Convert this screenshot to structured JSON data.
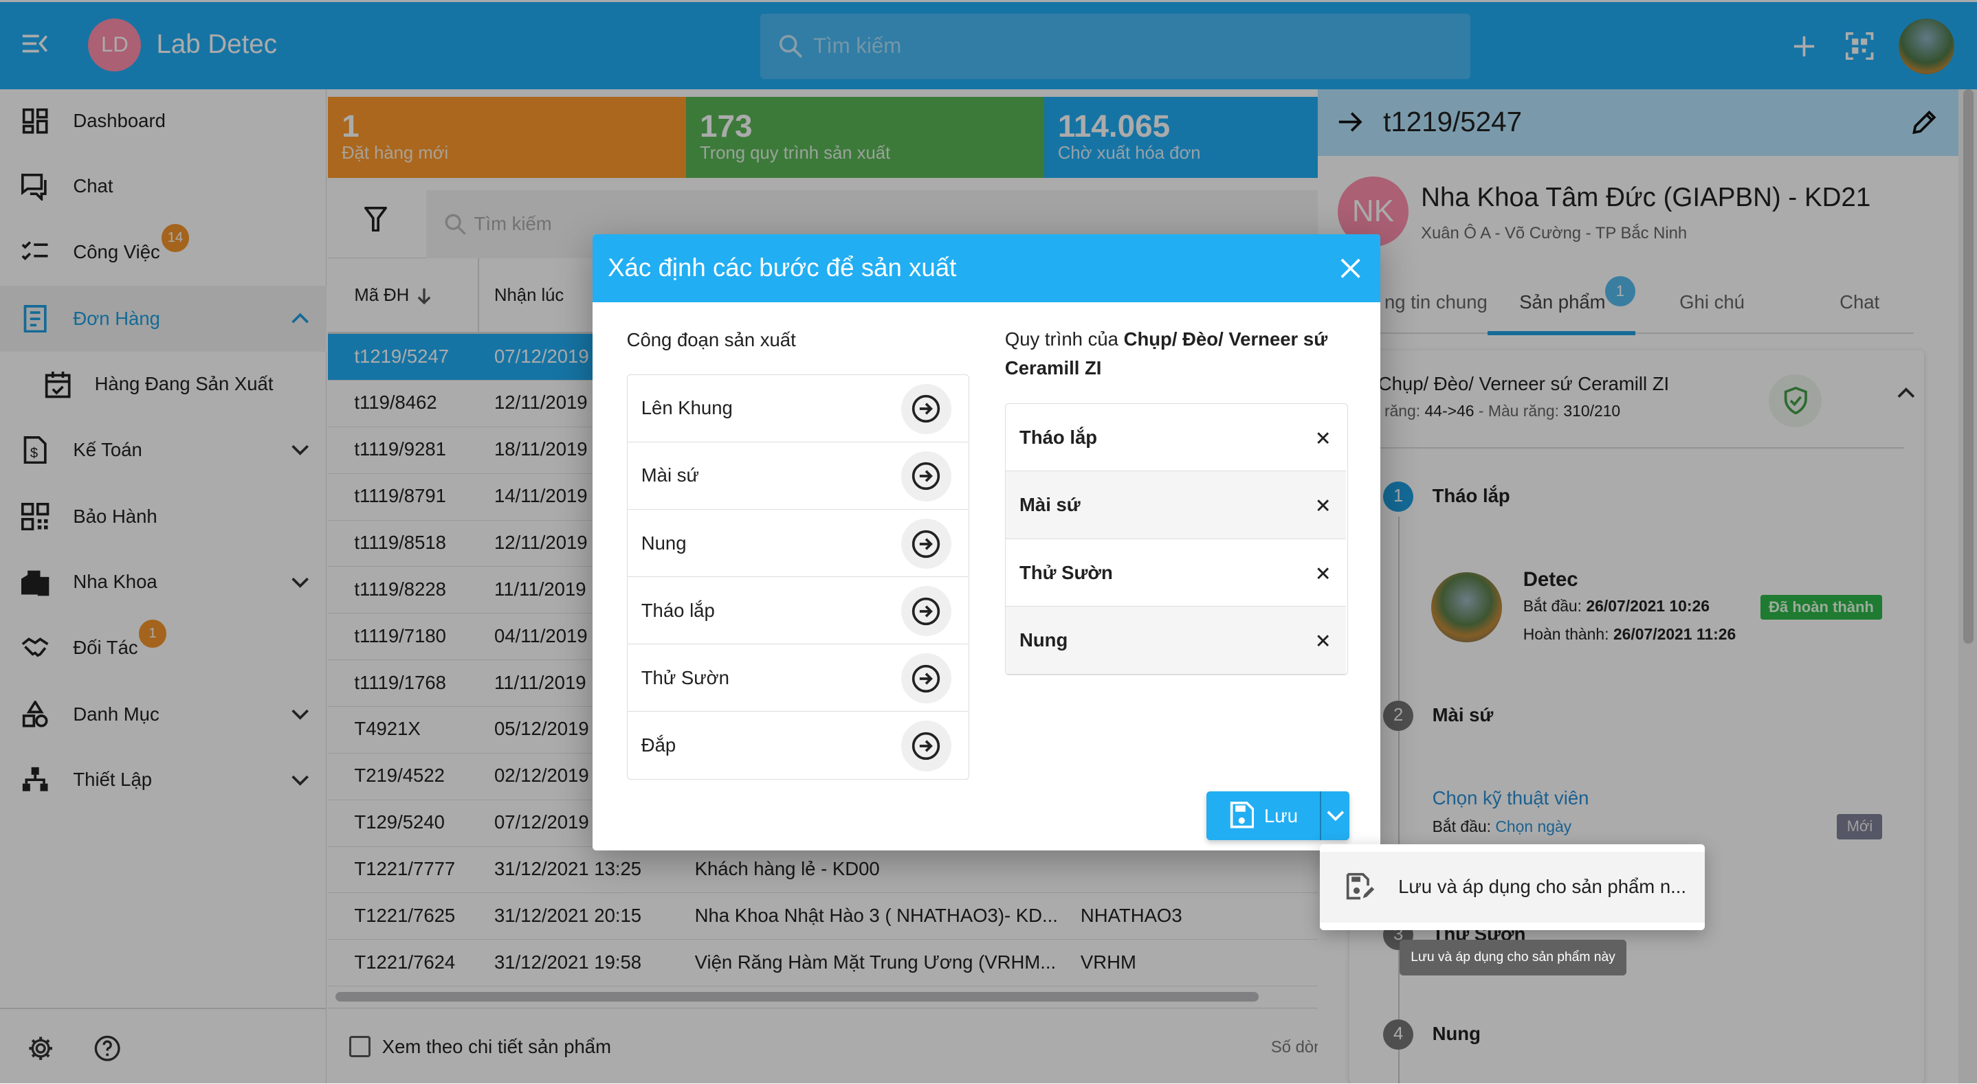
{
  "app": {
    "logo_initials": "LD",
    "title": "Lab Detec",
    "search_placeholder": "Tìm kiếm"
  },
  "sidebar": {
    "items": [
      {
        "label": "Dashboard",
        "icon": "dashboard-icon"
      },
      {
        "label": "Chat",
        "icon": "chat-icon"
      },
      {
        "label": "Công Việc",
        "icon": "checklist-icon",
        "badge": "14"
      },
      {
        "label": "Đơn Hàng",
        "icon": "document-icon",
        "active": true,
        "expanded": true
      },
      {
        "label": "Hàng Đang Sản Xuất",
        "icon": "calendar-icon",
        "sub": true
      },
      {
        "label": "Kế Toán",
        "icon": "invoice-icon",
        "expandable": true
      },
      {
        "label": "Bảo Hành",
        "icon": "qr-icon"
      },
      {
        "label": "Nha Khoa",
        "icon": "building-icon",
        "expandable": true
      },
      {
        "label": "Đối Tác",
        "icon": "handshake-icon",
        "badge": "1"
      },
      {
        "label": "Danh Mục",
        "icon": "category-icon",
        "expandable": true
      },
      {
        "label": "Thiết Lập",
        "icon": "network-icon",
        "expandable": true
      }
    ]
  },
  "stats": [
    {
      "value": "1",
      "label": "Đặt hàng mới",
      "color": "#fe9a2c"
    },
    {
      "value": "173",
      "label": "Trong quy trình sản xuất",
      "color": "#5ab657"
    },
    {
      "value": "114.065",
      "label": "Chờ xuất hóa đơn",
      "color": "#21adf5"
    }
  ],
  "table": {
    "search_placeholder": "Tìm kiếm",
    "columns": [
      "Mã ĐH",
      "Nhận lúc"
    ],
    "rows": [
      {
        "id": "t1219/5247",
        "date": "07/12/2019",
        "selected": true
      },
      {
        "id": "t119/8462",
        "date": "12/11/2019"
      },
      {
        "id": "t1119/9281",
        "date": "18/11/2019"
      },
      {
        "id": "t1119/8791",
        "date": "14/11/2019"
      },
      {
        "id": "t1119/8518",
        "date": "12/11/2019"
      },
      {
        "id": "t1119/8228",
        "date": "11/11/2019"
      },
      {
        "id": "t1119/7180",
        "date": "04/11/2019"
      },
      {
        "id": "t1119/1768",
        "date": "11/11/2019"
      },
      {
        "id": "T4921X",
        "date": "05/12/2019"
      },
      {
        "id": "T219/4522",
        "date": "02/12/2019"
      },
      {
        "id": "T129/5240",
        "date": "07/12/2019"
      },
      {
        "id": "T1221/7777",
        "date": "31/12/2021 13:25",
        "client": "Khách hàng lẻ - KD00",
        "code": ""
      },
      {
        "id": "T1221/7625",
        "date": "31/12/2021 20:15",
        "client": "Nha Khoa Nhật Hào 3 ( NHATHAO3)- KD...",
        "code": "NHATHAO3"
      },
      {
        "id": "T1221/7624",
        "date": "31/12/2021 19:58",
        "client": "Viện Răng Hàm Mặt Trung Ương (VRHM...",
        "code": "VRHM"
      }
    ],
    "footer_checkbox": "Xem theo chi tiết sản phẩm",
    "footer_rows": "Số dòn"
  },
  "detail": {
    "order_id": "t1219/5247",
    "clinic_initials": "NK",
    "clinic_name": "Nha Khoa Tâm Đức (GIAPBN) - KD21",
    "clinic_address": "Xuân Ô A - Võ Cường - TP Bắc Ninh",
    "tabs": [
      "ng tin chung",
      "Sản phẩm",
      "Ghi chú",
      "Chat"
    ],
    "tab_badge": "1",
    "product_title": "Chụp/ Đèo/ Verneer sứ Ceramill ZI",
    "product_teeth_label": "răng:",
    "product_teeth": "44->46",
    "product_color_label": "Màu răng:",
    "product_color": "310/210",
    "steps": [
      {
        "n": "1",
        "name": "Tháo lắp",
        "tech": "Detec",
        "start_label": "Bắt đầu:",
        "start": "26/07/2021 10:26",
        "done_label": "Hoàn thành:",
        "done": "26/07/2021 11:26",
        "status": "Đã hoàn thành"
      },
      {
        "n": "2",
        "name": "Mài sứ",
        "tech_link": "Chọn kỹ thuật viên",
        "start_label": "Bắt đầu:",
        "start_link": "Chọn ngày",
        "status": "Mới"
      },
      {
        "n": "3",
        "name": "Thử Sườn"
      },
      {
        "n": "4",
        "name": "Nung"
      }
    ]
  },
  "dialog": {
    "title": "Xác định các bước để sản xuất",
    "left_label": "Công đoạn sản xuất",
    "left_items": [
      "Lên Khung",
      "Mài sứ",
      "Nung",
      "Tháo lắp",
      "Thử Sườn",
      "Đắp"
    ],
    "right_label_prefix": "Quy trình của ",
    "right_label_product": "Chụp/ Đèo/ Verneer sứ Ceramill ZI",
    "right_items": [
      "Tháo lắp",
      "Mài sứ",
      "Thử Sườn",
      "Nung"
    ],
    "save_label": "Lưu"
  },
  "menu": {
    "item": "Lưu và áp dụng cho sản phẩm n..."
  },
  "tooltip": "Lưu và áp dụng cho sản phẩm này"
}
